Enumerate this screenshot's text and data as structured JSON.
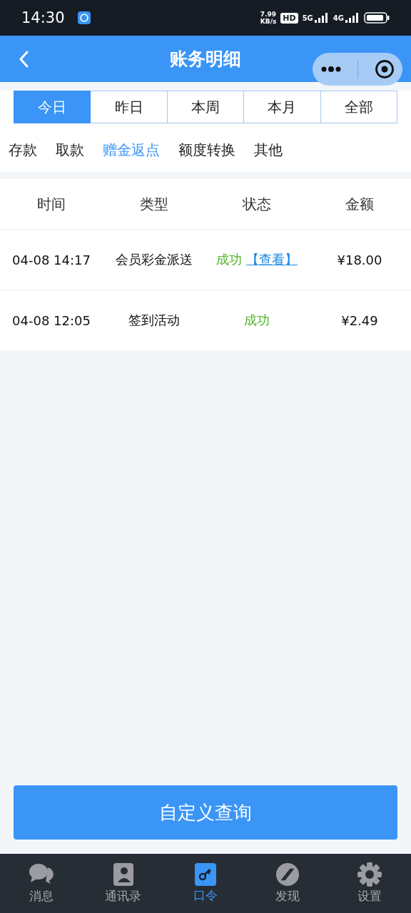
{
  "status_bar": {
    "time": "14:30",
    "speed_value": "7.99",
    "speed_unit": "KB/s",
    "hd": "HD",
    "network_1": "5G",
    "network_2": "4G"
  },
  "header": {
    "title": "账务明细"
  },
  "periods": [
    {
      "label": "今日",
      "selected": true
    },
    {
      "label": "昨日",
      "selected": false
    },
    {
      "label": "本周",
      "selected": false
    },
    {
      "label": "本月",
      "selected": false
    },
    {
      "label": "全部",
      "selected": false
    }
  ],
  "categories": [
    {
      "label": "存款",
      "selected": false
    },
    {
      "label": "取款",
      "selected": false
    },
    {
      "label": "赠金返点",
      "selected": true
    },
    {
      "label": "额度转换",
      "selected": false
    },
    {
      "label": "其他",
      "selected": false
    }
  ],
  "table": {
    "columns": [
      "时间",
      "类型",
      "状态",
      "金额"
    ],
    "rows": [
      {
        "time": "04-08 14:17",
        "type": "会员彩金派送",
        "status": "成功",
        "link": "【查看】",
        "amount": "¥18.00"
      },
      {
        "time": "04-08 12:05",
        "type": "签到活动",
        "status": "成功",
        "amount": "¥2.49"
      }
    ]
  },
  "query_button": "自定义查询",
  "tab_bar": [
    {
      "label": "消息",
      "selected": false
    },
    {
      "label": "通讯录",
      "selected": false
    },
    {
      "label": "口令",
      "selected": true
    },
    {
      "label": "发现",
      "selected": false
    },
    {
      "label": "设置",
      "selected": false
    }
  ]
}
